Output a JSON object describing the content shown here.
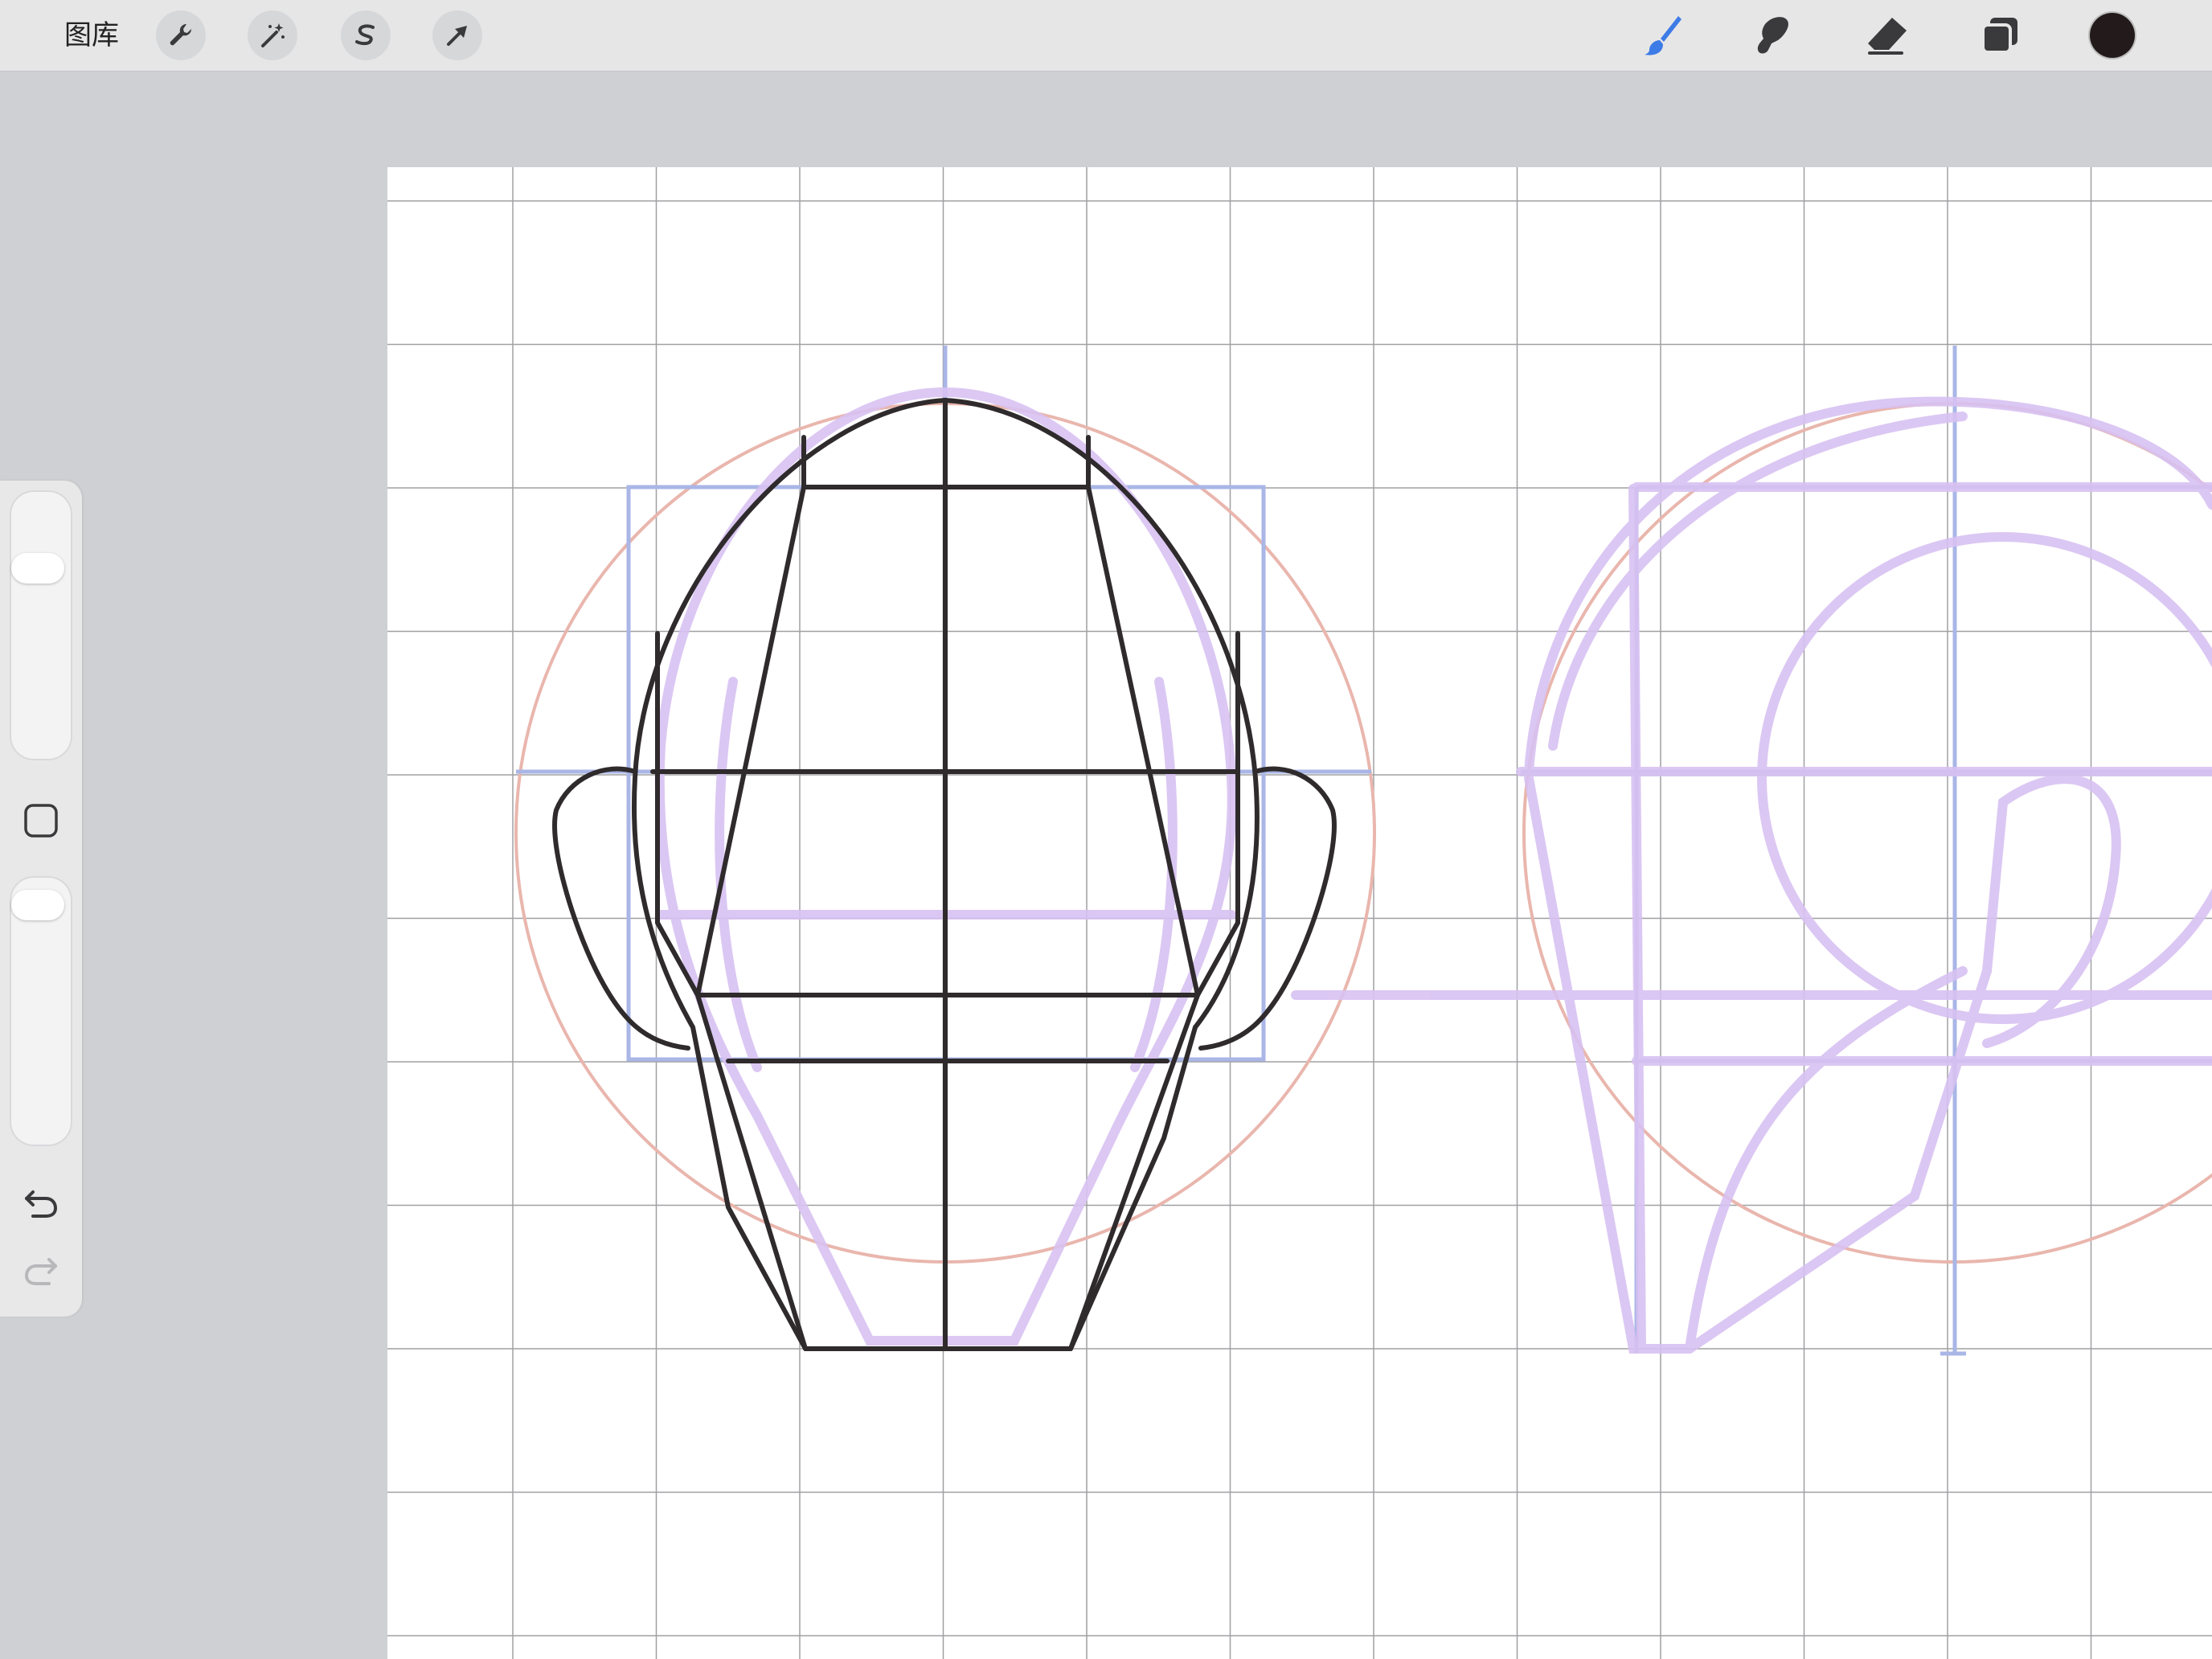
{
  "toolbar": {
    "gallery_label": "图库",
    "left_tools": [
      {
        "name": "actions",
        "icon": "wrench-icon"
      },
      {
        "name": "adjustments",
        "icon": "magic-wand-icon"
      },
      {
        "name": "selection",
        "icon": "selection-s-icon"
      },
      {
        "name": "transform",
        "icon": "arrow-cursor-icon"
      }
    ],
    "right_tools": [
      {
        "name": "brush",
        "icon": "brush-icon",
        "active": true
      },
      {
        "name": "smudge",
        "icon": "smudge-finger-icon",
        "active": false
      },
      {
        "name": "eraser",
        "icon": "eraser-icon",
        "active": false
      },
      {
        "name": "layers",
        "icon": "layers-icon",
        "active": false
      }
    ],
    "current_color": "#231a1b",
    "active_tool_color": "#3d7be6"
  },
  "sidebar": {
    "brush_size_level": 0.74,
    "opacity_level": 0.95,
    "modify_button_icon": "square-icon",
    "undo_icon": "undo-icon",
    "redo_icon": "redo-icon",
    "redo_enabled": false
  },
  "canvas": {
    "grid_color": "#a0a0a4",
    "sketch_colors": {
      "ink": "#2f2a2c",
      "purple_construction": "#d8c2f2",
      "red_circle": "#e9b6ad",
      "blue_guides": "#a9b6e6"
    }
  }
}
